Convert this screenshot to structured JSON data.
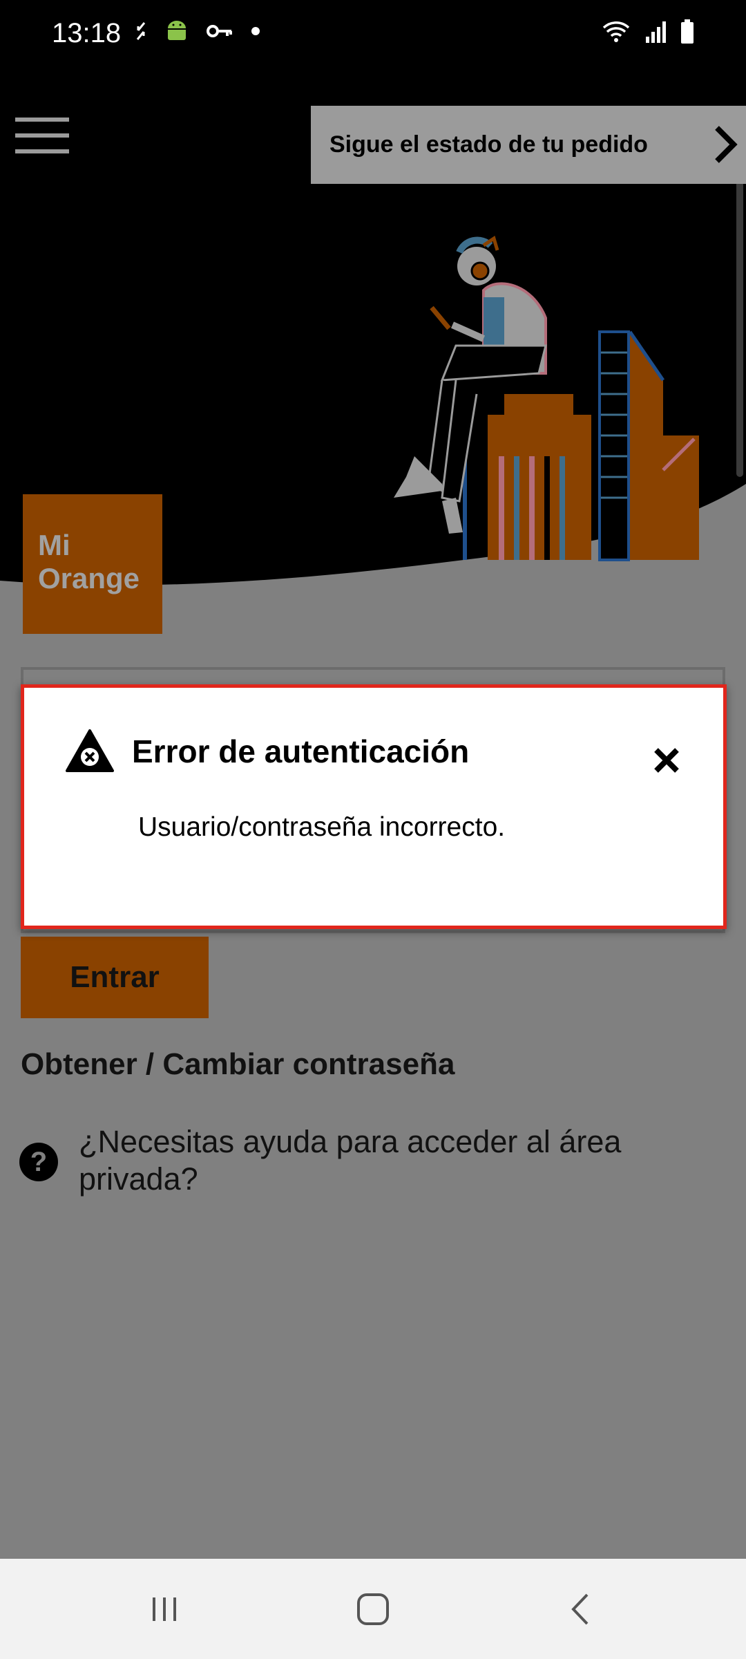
{
  "status_bar": {
    "time": "13:18",
    "left_icons": [
      "sync-off-icon",
      "android-icon",
      "key-icon",
      "dot-icon"
    ],
    "right_icons": [
      "wifi-icon",
      "signal-icon",
      "battery-icon"
    ]
  },
  "header": {
    "menu_icon": "hamburger-menu-icon",
    "order_banner": {
      "label": "Sigue el estado de tu pedido",
      "icon": "chevron-right-icon"
    }
  },
  "logo": {
    "line1": "Mi",
    "line2": "Orange"
  },
  "login": {
    "enter_button": "Entrar",
    "password_link": "Obtener / Cambiar contraseña",
    "help_text": "¿Necesitas ayuda para acceder al área privada?",
    "help_icon_glyph": "?"
  },
  "dialog": {
    "title": "Error de autenticación",
    "message": "Usuario/contraseña incorrecto.",
    "icon": "warning-error-icon",
    "close_icon": "close-icon",
    "border_color": "#e1261c"
  },
  "nav_bar": {
    "buttons": [
      "recents-icon",
      "home-icon",
      "back-icon"
    ]
  },
  "colors": {
    "brand_orange_dimmed": "#8a4200",
    "overlay_gray": "#808080"
  }
}
